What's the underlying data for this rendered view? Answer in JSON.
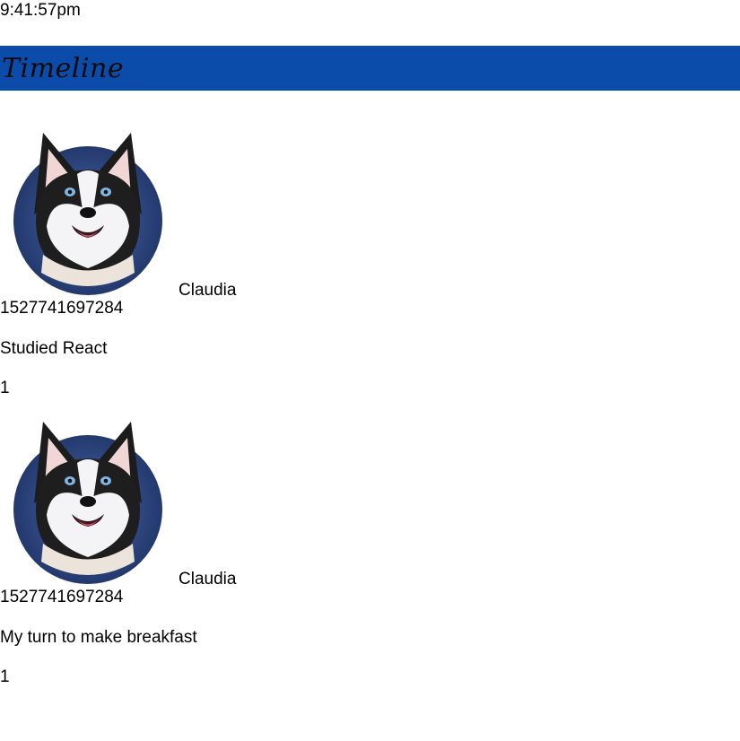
{
  "clock": "9:41:57pm",
  "header": {
    "title": "Timeline",
    "bg_color": "#0b4cab"
  },
  "posts": [
    {
      "author": "Claudia",
      "timestamp": "1527741697284",
      "text": "Studied React",
      "likes": "1",
      "avatar_icon": "husky-dog-avatar"
    },
    {
      "author": "Claudia",
      "timestamp": "1527741697284",
      "text": "My turn to make breakfast",
      "likes": "1",
      "avatar_icon": "husky-dog-avatar"
    }
  ]
}
